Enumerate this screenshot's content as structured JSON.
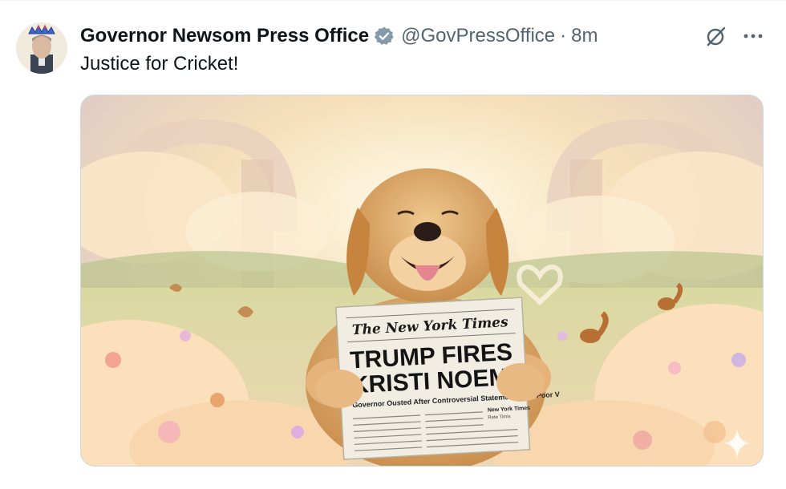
{
  "post": {
    "display_name": "Governor Newsom Press Office",
    "handle": "@GovPressOffice",
    "separator": "·",
    "time": "8m",
    "text": "Justice for Cricket!"
  },
  "icons": {
    "verified": "verified-badge-icon",
    "grok": "grok-icon",
    "more": "more-options-icon",
    "sparkle": "ai-sparkle-icon"
  },
  "media": {
    "newspaper": {
      "masthead": "The New York Times",
      "headline_line1": "TRUMP FIRES",
      "headline_line2": "KRISTI NOEM",
      "subhead": "Governor Ousted After Controversial Statements and Poor V",
      "side_head": "New York Times",
      "side_sub": "Rete Timis"
    }
  },
  "colors": {
    "name": "#0f1419",
    "secondary": "#536471",
    "verified": "#829aab",
    "border": "#cfd9de"
  }
}
